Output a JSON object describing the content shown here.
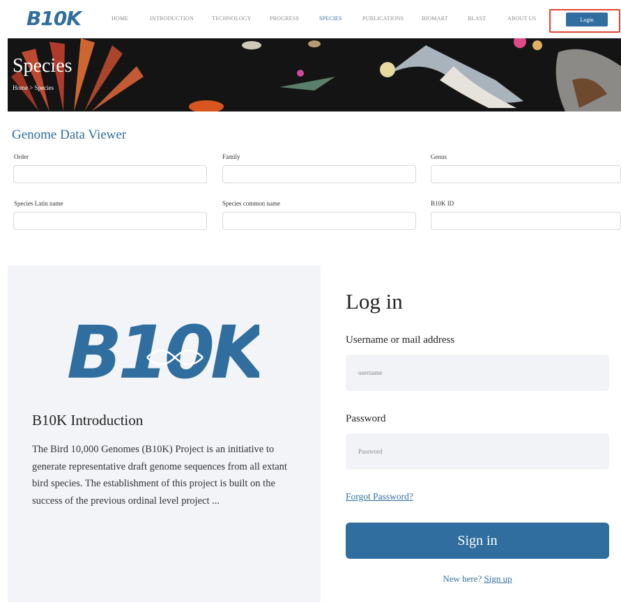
{
  "brand": {
    "logo_text": "B10K",
    "accent_color": "#2f6e9e",
    "highlight_color": "#e0452f"
  },
  "nav": {
    "items": [
      {
        "label": "HOME"
      },
      {
        "label": "INTRODUCTION"
      },
      {
        "label": "TECHNOLOGY"
      },
      {
        "label": "PROGRESS"
      },
      {
        "label": "SPECIES",
        "active": true
      },
      {
        "label": "PUBLICATIONS"
      },
      {
        "label": "BIOMART"
      },
      {
        "label": "BLAST"
      },
      {
        "label": "ABOUT US"
      }
    ],
    "login_label": "Login"
  },
  "banner": {
    "title": "Species",
    "breadcrumb": "Home > Species"
  },
  "genome_viewer": {
    "title": "Genome Data Viewer",
    "fields": [
      {
        "label": "Order"
      },
      {
        "label": "Family"
      },
      {
        "label": "Genus"
      },
      {
        "label": "Species Latin name"
      },
      {
        "label": "Species common name"
      },
      {
        "label": "B10K ID"
      }
    ]
  },
  "intro": {
    "logo_text": "B10K",
    "heading": "B10K Introduction",
    "text": "The Bird 10,000 Genomes (B10K) Project is an initiative to generate representative draft genome sequences from all extant bird species. The establishment of this project is built on the success of the previous ordinal level project ..."
  },
  "login": {
    "title": "Log in",
    "username_label": "Username or mail address",
    "username_placeholder": "username",
    "password_label": "Password",
    "password_placeholder": "Password",
    "forgot": "Forgot Password?",
    "signin": "Sign in",
    "new_here": "New here?",
    "signup": "Sign up"
  }
}
